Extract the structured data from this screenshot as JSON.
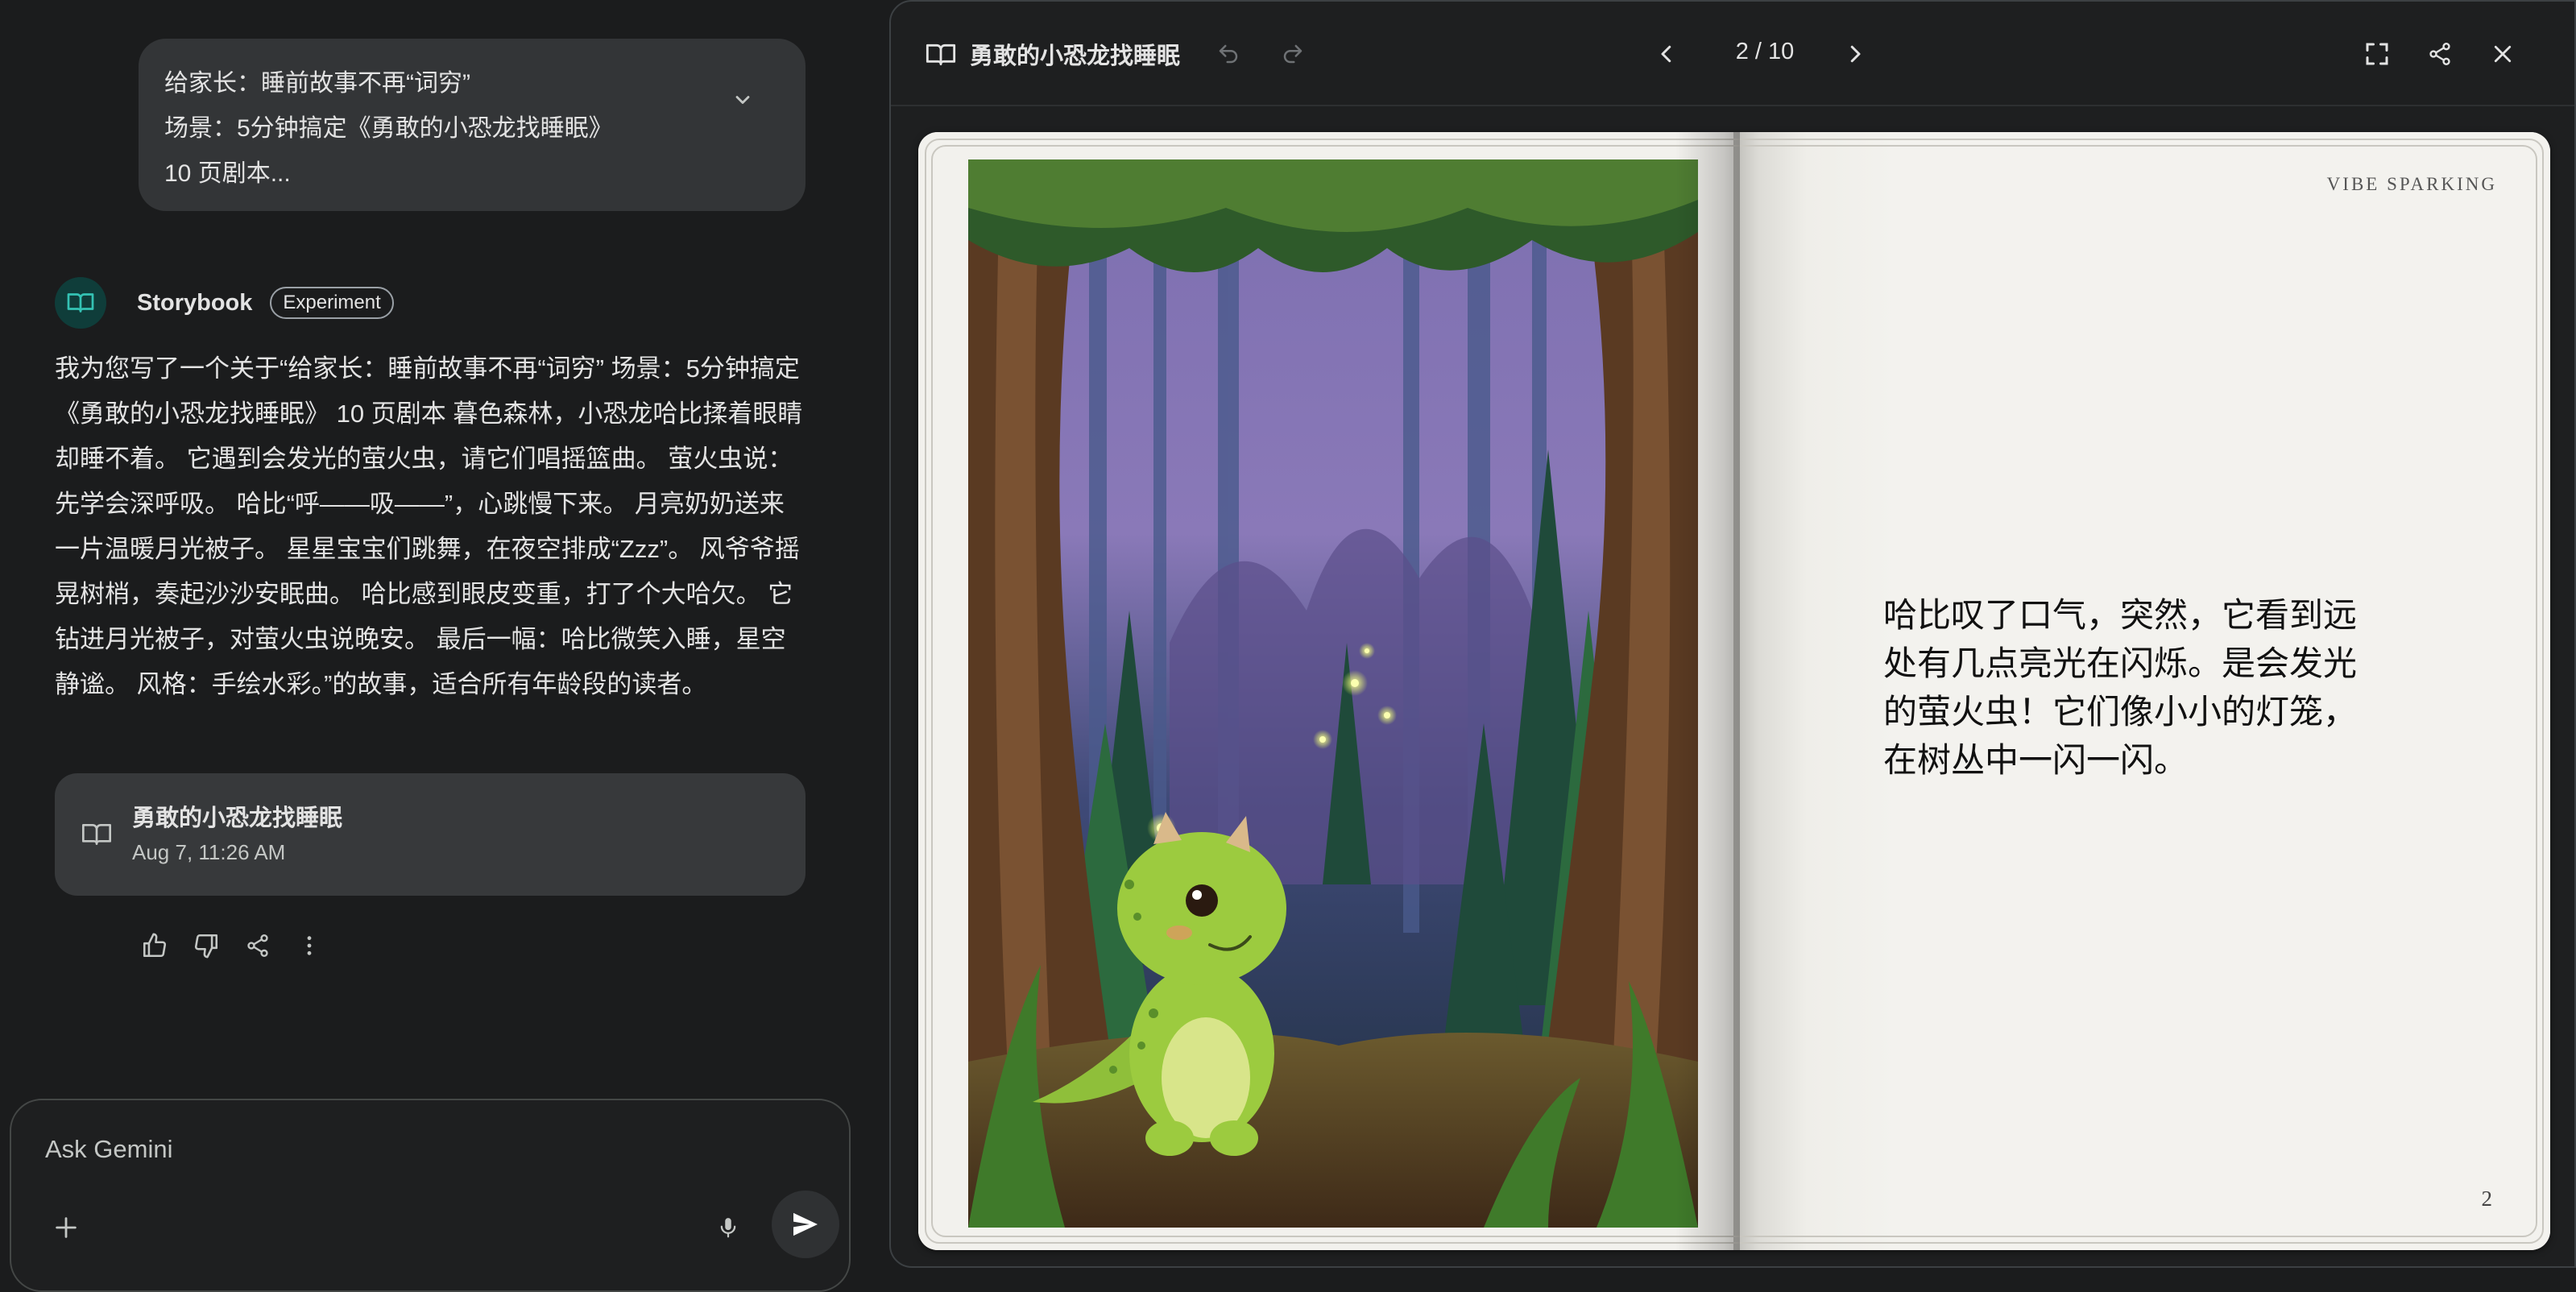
{
  "user_prompt": {
    "lines": [
      "给家长：睡前故事不再“词穷”",
      "场景：5分钟搞定《勇敢的小恐龙找睡眠》",
      "10 页剧本..."
    ]
  },
  "model": {
    "name": "Storybook",
    "badge": "Experiment",
    "response": "我为您写了一个关于“给家长：睡前故事不再“词穷” 场景：5分钟搞定《勇敢的小恐龙找睡眠》 10 页剧本 暮色森林，小恐龙哈比揉着眼睛却睡不着。 它遇到会发光的萤火虫，请它们唱摇篮曲。 萤火虫说：先学会深呼吸。 哈比“呼——吸——”，心跳慢下来。 月亮奶奶送来一片温暖月光被子。 星星宝宝们跳舞，在夜空排成“Zzz”。 风爷爷摇晃树梢，奏起沙沙安眠曲。 哈比感到眼皮变重，打了个大哈欠。 它钻进月光被子，对萤火虫说晚安。 最后一幅：哈比微笑入睡，星空静谧。 风格：手绘水彩。”的故事，适合所有年龄段的读者。"
  },
  "story_card": {
    "title": "勇敢的小恐龙找睡眠",
    "date": "Aug 7, 11:26 AM"
  },
  "input": {
    "placeholder": "Ask Gemini"
  },
  "viewer": {
    "title": "勇敢的小恐龙找睡眠",
    "page_indicator": "2 / 10"
  },
  "book": {
    "brand": "VIBE SPARKING",
    "page_text": "哈比叹了口气，突然，它看到远处有几点亮光在闪烁。是会发光的萤火虫！它们像小小的灯笼，在树丛中一闪一闪。",
    "page_number": "2"
  },
  "icons": {
    "book": "book-open-icon",
    "undo": "undo-icon",
    "redo": "redo-icon",
    "prev": "chevron-left-icon",
    "next": "chevron-right-icon",
    "fullscreen": "fullscreen-icon",
    "share": "share-icon",
    "close": "close-icon"
  },
  "colors": {
    "background": "#1b1c1d",
    "bubble": "#333537",
    "avatar": "#0f3d3a",
    "avatar_icon": "#34c2b4",
    "page": "#f3f2ee"
  }
}
